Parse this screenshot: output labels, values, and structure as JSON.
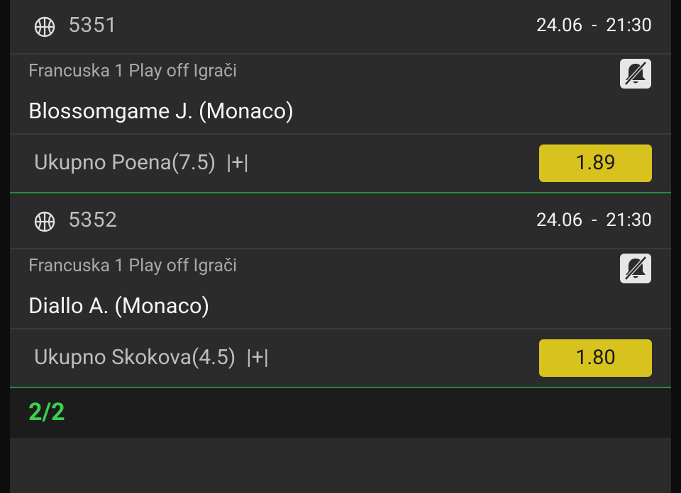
{
  "events": [
    {
      "code": "5351",
      "date": "24.06",
      "time": "21:30",
      "datetime_text": "24.06  -  21:30",
      "league": "Francuska 1 Play off Igrači",
      "player": "Blossomgame J. (Monaco)",
      "market": "Ukupno Poena(7.5)  |+|",
      "odds": "1.89",
      "sport_icon": "basketball-icon",
      "bell_icon": "bell-off-icon"
    },
    {
      "code": "5352",
      "date": "24.06",
      "time": "21:30",
      "datetime_text": "24.06  -  21:30",
      "league": "Francuska 1 Play off Igrači",
      "player": "Diallo A. (Monaco)",
      "market": "Ukupno Skokova(4.5)  |+|",
      "odds": "1.80",
      "sport_icon": "basketball-icon",
      "bell_icon": "bell-off-icon"
    }
  ],
  "footer": {
    "counter": "2/2"
  },
  "colors": {
    "background": "#2b2b2b",
    "odds_button": "#d8c21e",
    "accent_green": "#3bcf4f",
    "separator_green": "#1f8f3a"
  }
}
